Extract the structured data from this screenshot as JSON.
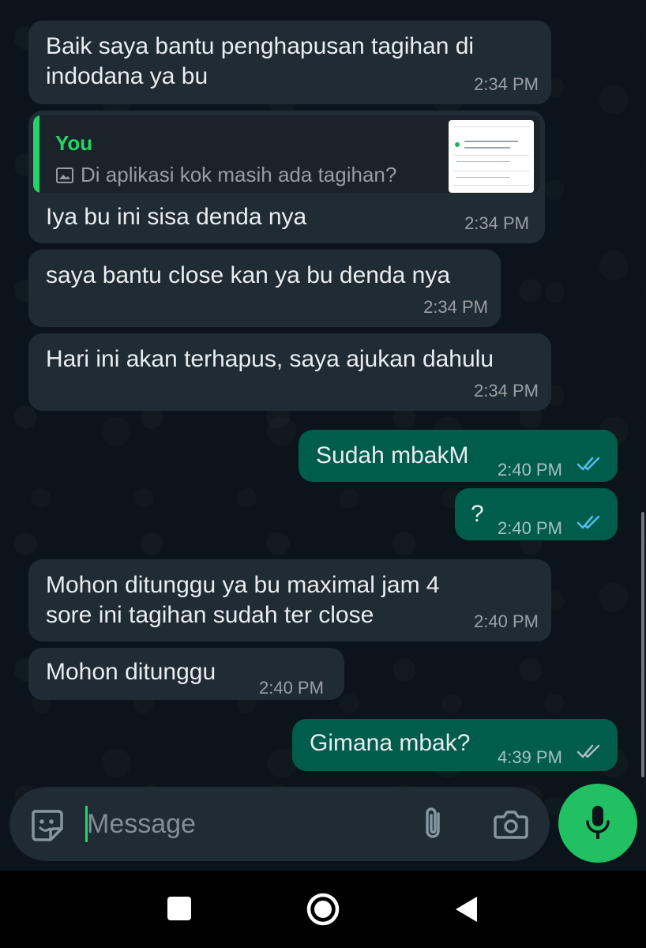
{
  "colors": {
    "background": "#0b141a",
    "incoming_bubble": "#202c33",
    "outgoing_bubble": "#005c4b",
    "accent": "#25d366",
    "read_ticks": "#53bdeb",
    "delivered_ticks": "#aebac1"
  },
  "messages": [
    {
      "direction": "in",
      "lines": [
        "Baik saya bantu penghapusan tagihan di",
        "indodana ya bu"
      ],
      "time": "2:34 PM"
    },
    {
      "direction": "in",
      "reply_to": {
        "author": "You",
        "icon": "image-icon",
        "text": "Di aplikasi kok masih ada tagihan?"
      },
      "lines": [
        "Iya bu ini sisa denda nya"
      ],
      "time": "2:34 PM"
    },
    {
      "direction": "in",
      "lines": [
        "saya bantu close kan ya bu denda nya"
      ],
      "time": "2:34 PM"
    },
    {
      "direction": "in",
      "lines": [
        "Hari ini akan terhapus, saya ajukan dahulu"
      ],
      "time": "2:34 PM"
    },
    {
      "direction": "out",
      "lines": [
        "Sudah mbakM"
      ],
      "time": "2:40 PM",
      "status": "read"
    },
    {
      "direction": "out",
      "lines": [
        "?"
      ],
      "time": "2:40 PM",
      "status": "read"
    },
    {
      "direction": "in",
      "lines": [
        "Mohon ditunggu ya bu maximal jam 4",
        "sore ini tagihan sudah ter close"
      ],
      "time": "2:40 PM"
    },
    {
      "direction": "in",
      "lines": [
        "Mohon ditunggu"
      ],
      "time": "2:40 PM"
    },
    {
      "direction": "out",
      "lines": [
        "Gimana mbak?"
      ],
      "time": "4:39 PM",
      "status": "delivered"
    }
  ],
  "composer": {
    "placeholder": "Message",
    "icons": [
      "sticker-icon",
      "attach-icon",
      "camera-icon",
      "mic-icon"
    ]
  },
  "navbar": {
    "icons": [
      "recents-icon",
      "home-icon",
      "back-icon"
    ]
  }
}
